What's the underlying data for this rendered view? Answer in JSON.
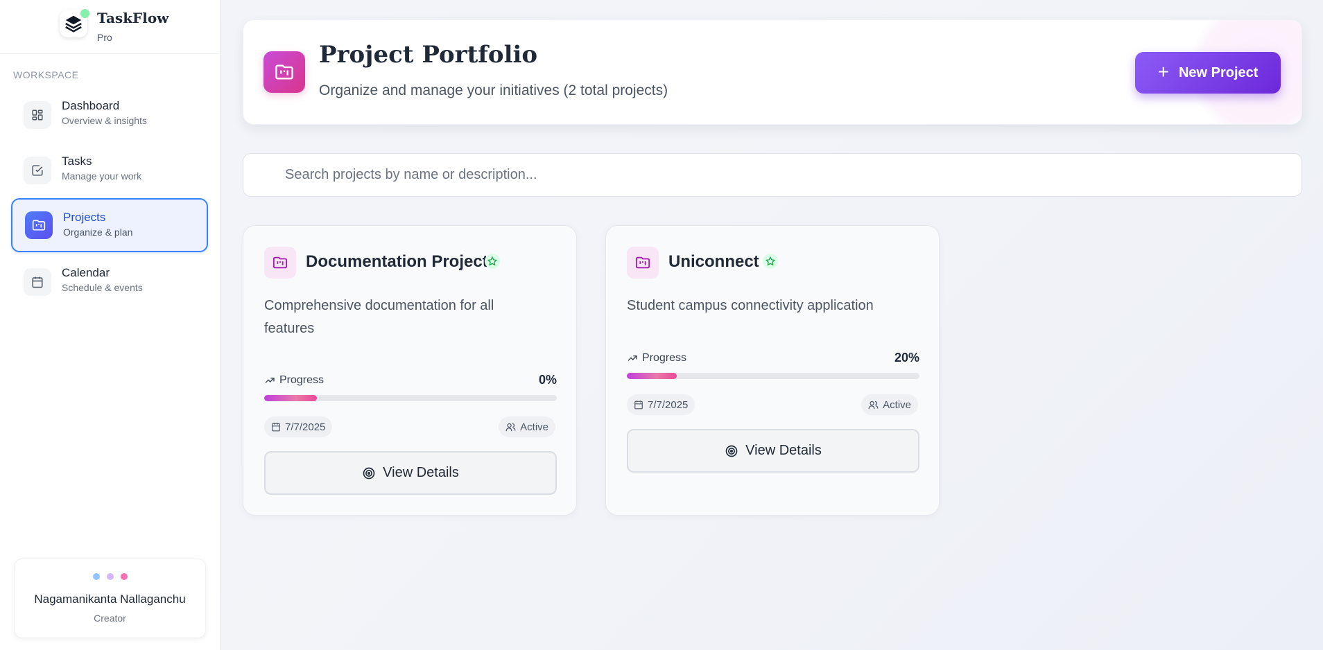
{
  "brand": {
    "name": "TaskFlow",
    "tier": "Pro"
  },
  "sidebar": {
    "section_label": "WORKSPACE",
    "items": [
      {
        "title": "Dashboard",
        "subtitle": "Overview & insights",
        "icon": "dashboard-grid-icon"
      },
      {
        "title": "Tasks",
        "subtitle": "Manage your work",
        "icon": "checkbox-icon"
      },
      {
        "title": "Projects",
        "subtitle": "Organize & plan",
        "icon": "folder-kanban-icon",
        "active": true
      },
      {
        "title": "Calendar",
        "subtitle": "Schedule & events",
        "icon": "calendar-icon"
      }
    ]
  },
  "profile": {
    "name": "Nagamanikanta Nallaganchu",
    "role": "Creator",
    "dot_colors": [
      "#93c5fd",
      "#d8b4fe",
      "#f472b6"
    ]
  },
  "header": {
    "title": "Project Portfolio",
    "subtitle": "Organize and manage your initiatives (2 total projects)",
    "new_button_label": "New Project"
  },
  "search": {
    "placeholder": "Search projects by name or description...",
    "value": ""
  },
  "projects": [
    {
      "title": "Documentation Project",
      "description": "Comprehensive documentation for all features",
      "progress_label": "Progress",
      "progress_text": "0%",
      "progress_fill": 0.18,
      "date": "7/7/2025",
      "status": "Active",
      "button_label": "View Details"
    },
    {
      "title": "Uniconnect",
      "description": "Student campus connectivity application",
      "progress_label": "Progress",
      "progress_text": "20%",
      "progress_fill": 0.17,
      "date": "7/7/2025",
      "status": "Active",
      "button_label": "View Details"
    }
  ],
  "colors": {
    "accent_purple": "#7c3aed",
    "active_blue": "#3b82f6",
    "brand_pink": "#d9368c",
    "star_green": "#22c55e"
  }
}
